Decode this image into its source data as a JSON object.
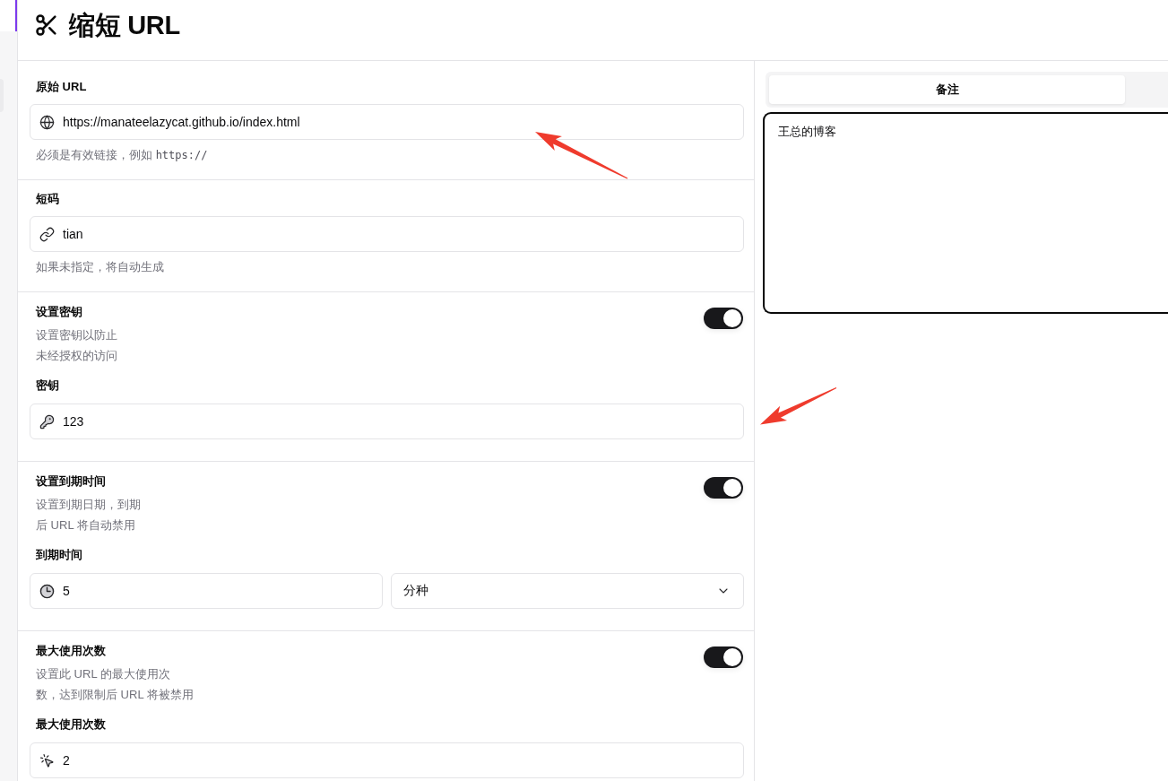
{
  "header": {
    "title": "缩短 URL"
  },
  "form": {
    "sections": [
      {
        "kind": "field",
        "label": "原始 URL",
        "input": {
          "kind": "url",
          "value": "https://manateelazycat.github.io/index.html"
        },
        "hint": "必须是有效链接，例如",
        "hint_code": "https://"
      },
      {
        "kind": "field",
        "label": "短码",
        "input": {
          "kind": "alias",
          "value": "tian"
        },
        "hint": "如果未指定，将自动生成"
      },
      {
        "kind": "option",
        "title": "设置密钥",
        "description": [
          "设置密钥以防止",
          "未经授权的访问"
        ],
        "on": true,
        "label": "密钥",
        "input": {
          "kind": "password",
          "value": "123"
        }
      },
      {
        "kind": "option",
        "title": "设置到期时间",
        "description": [
          "设置到期日期，到期",
          "后 URL 将自动禁用"
        ],
        "on": true,
        "label": "到期时间",
        "input": {
          "kind": "duration",
          "value": "5"
        },
        "unit": {
          "value": "分种"
        }
      },
      {
        "kind": "option",
        "title": "最大使用次数",
        "description": [
          "设置此 URL 的最大使用次",
          "数，达到限制后 URL 将被禁用"
        ],
        "on": true,
        "label": "最大使用次数",
        "input": {
          "kind": "count",
          "value": "2"
        }
      }
    ]
  },
  "side_panel": {
    "tabs": [
      {
        "label": "备注",
        "selected": true
      }
    ],
    "notes": {
      "value": "王总的博客",
      "focused": true
    }
  }
}
